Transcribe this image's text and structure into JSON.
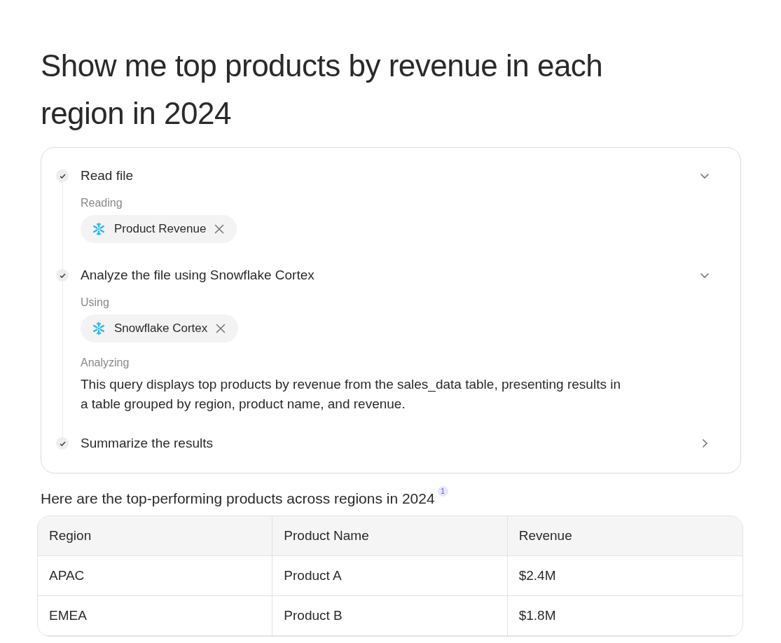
{
  "heading": "Show me top products by revenue in each region in 2024",
  "steps": [
    {
      "title": "Read file",
      "done": true,
      "expanded": true,
      "details": [
        {
          "kind": "label",
          "text": "Reading"
        },
        {
          "kind": "chip",
          "text": "Product Revenue"
        }
      ]
    },
    {
      "title": "Analyze the file using Snowflake Cortex",
      "done": true,
      "expanded": true,
      "details": [
        {
          "kind": "label",
          "text": "Using"
        },
        {
          "kind": "chip",
          "text": "Snowflake Cortex"
        },
        {
          "kind": "label",
          "text": "Analyzing"
        },
        {
          "kind": "text",
          "text": "This query displays top products by revenue from the sales_data table, presenting results in a table grouped by region, product name, and revenue."
        }
      ]
    },
    {
      "title": "Summarize the results",
      "done": true,
      "expanded": false
    }
  ],
  "answer": {
    "text": "Here are the top-performing products across regions in 2024",
    "footnote": "1"
  },
  "table": {
    "columns": [
      "Region",
      "Product Name",
      "Revenue"
    ],
    "rows": [
      [
        "APAC",
        "Product A",
        "$2.4M"
      ],
      [
        "EMEA",
        "Product B",
        "$1.8M"
      ]
    ]
  }
}
